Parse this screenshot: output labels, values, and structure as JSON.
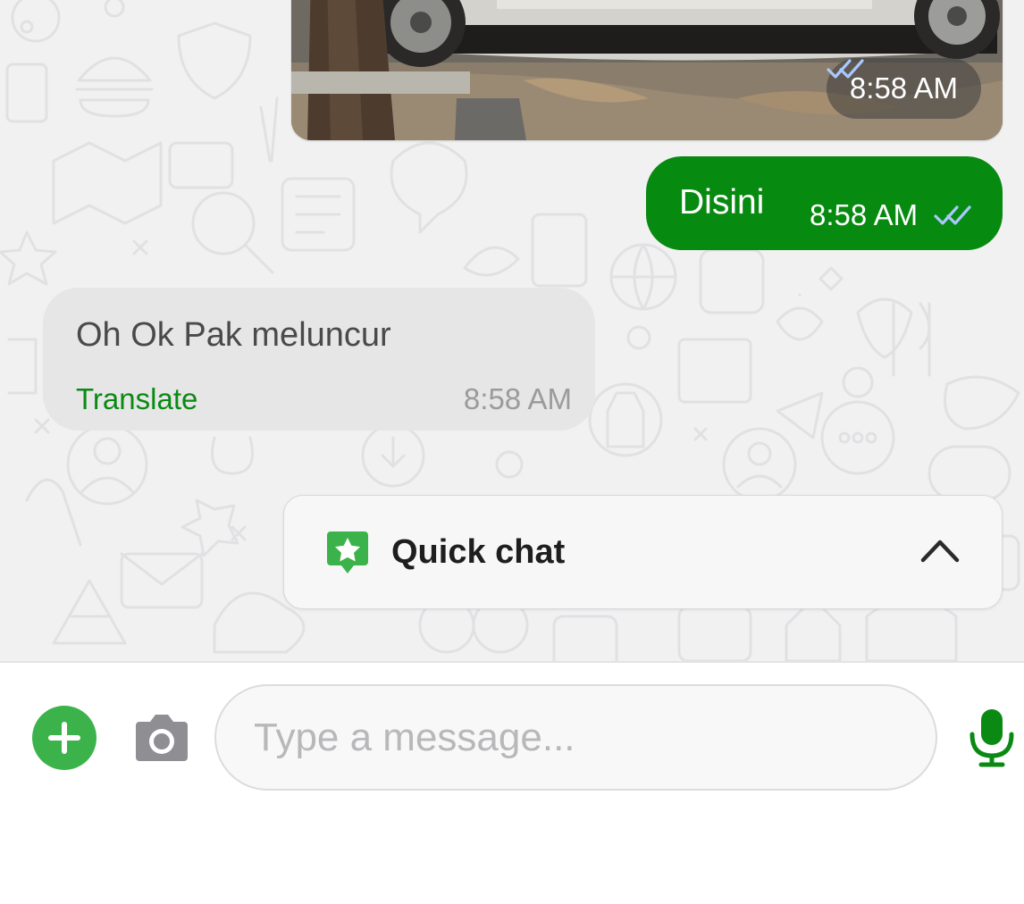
{
  "messages": {
    "image_message": {
      "time": "8:58 AM",
      "status_icon": "double-check-icon"
    },
    "outgoing": {
      "text": "Disini",
      "time": "8:58 AM",
      "status_icon": "double-check-icon"
    },
    "incoming": {
      "text": "Oh Ok Pak meluncur",
      "translate_label": "Translate",
      "time": "8:58 AM"
    }
  },
  "quick_chat": {
    "label": "Quick chat",
    "icon": "star-chat-icon",
    "toggle_icon": "chevron-up-icon"
  },
  "composer": {
    "placeholder": "Type a message...",
    "add_icon": "plus-icon",
    "camera_icon": "camera-icon",
    "mic_icon": "microphone-icon"
  },
  "colors": {
    "outgoing_bubble": "#078a10",
    "incoming_bubble": "#e6e6e7",
    "accent_green": "#3cb34a",
    "link_green": "#0a8a12",
    "chat_background": "#f1f1f2"
  }
}
